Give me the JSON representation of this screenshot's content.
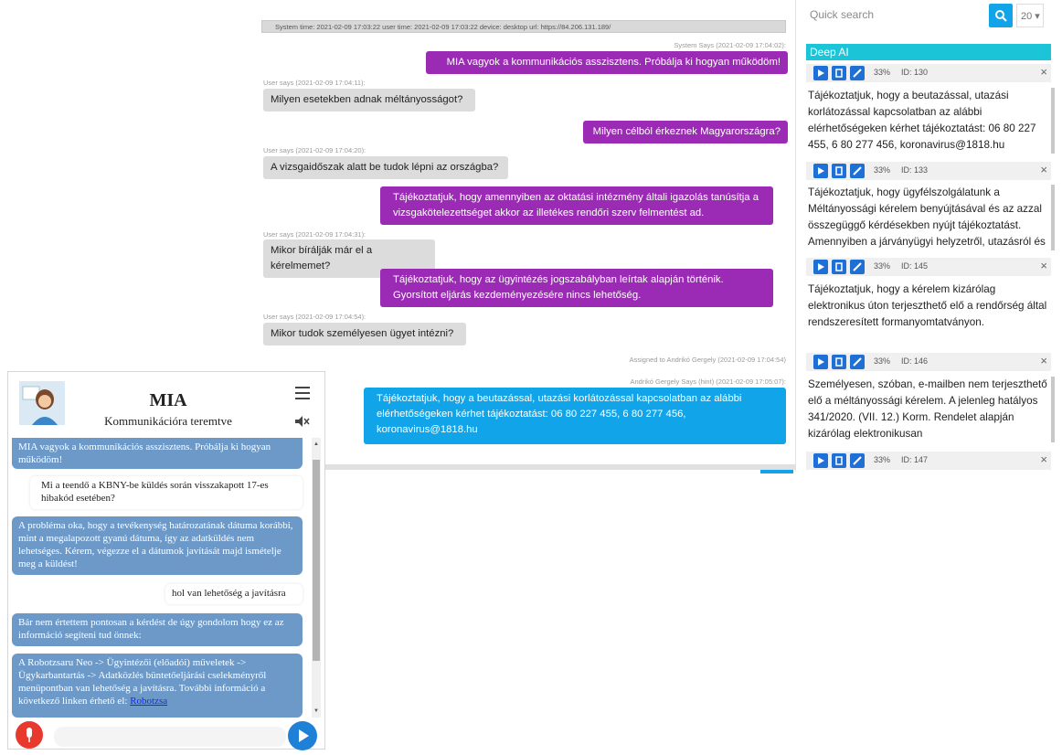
{
  "console": {
    "system_bar": "System time: 2021-02-09 17:03:22  user time: 2021-02-09 17:03:22  device: desktop  url: https://84.206.131.189/",
    "messages": [
      {
        "meta": "System Says (2021-02-09 17:04:02):",
        "text": "MIA vagyok a kommunikációs asszisztens. Próbálja ki hogyan működöm!"
      },
      {
        "meta": "User says (2021-02-09 17:04:11):",
        "text": "Milyen esetekben adnak méltányosságot?"
      },
      {
        "meta": "",
        "text": "Milyen célból érkeznek Magyarországra?"
      },
      {
        "meta": "User says (2021-02-09 17:04:20):",
        "text": "A vizsgaidőszak alatt be tudok lépni az országba?"
      },
      {
        "meta": "",
        "text": "Tájékoztatjuk, hogy amennyiben az oktatási intézmény általi igazolás tanúsítja a vizsgakötelezettséget akkor az illetékes rendőri szerv felmentést ad."
      },
      {
        "meta": "User says (2021-02-09 17:04:31):",
        "text": "Mikor bírálják már el a kérelmemet?"
      },
      {
        "meta": "",
        "text": "Tájékoztatjuk, hogy az ügyintézés jogszabályban leírtak alapján történik. Gyorsított eljárás kezdeményezésére nincs lehetőség."
      },
      {
        "meta": "User says (2021-02-09 17:04:54):",
        "text": "Mikor tudok személyesen ügyet intézni?"
      },
      {
        "meta": "Assigned to Andrikó Gergely (2021-02-09 17:04:54)",
        "text": ""
      },
      {
        "meta": "Andrikó Gergely Says (hint) (2021-02-09 17:05:07):",
        "text": "Tájékoztatjuk, hogy a beutazással, utazási korlátozással kapcsolatban az alábbi elérhetőségeken kérhet tájékoztatást: 06 80 227 455, 6 80 277 456, koronavirus@1818.hu"
      }
    ]
  },
  "right_panel": {
    "search_placeholder": "Quick search",
    "count": "20 ▾",
    "section_title": "Deep AI",
    "cards": [
      {
        "pct": "33%",
        "id": "ID: 130",
        "text": "Tájékoztatjuk, hogy a beutazással, utazási korlátozással kapcsolatban az alábbi elérhetőségeken kérhet tájékoztatást: 06 80 227 455, 6 80 277 456, koronavirus@1818.hu"
      },
      {
        "pct": "33%",
        "id": "ID: 133",
        "text": "Tájékoztatjuk, hogy ügyfélszolgálatunk a Méltányossági kérelem benyújtásával és az azzal összegüggő kérdésekben nyújt tájékoztatást. Amennyiben a járványügyi helyzetről, utazásról és"
      },
      {
        "pct": "33%",
        "id": "ID: 145",
        "text": "Tájékoztatjuk, hogy a kérelem kizárólag elektronikus úton terjeszthető elő a rendőrség által rendszeresített formanyomtatványon."
      },
      {
        "pct": "33%",
        "id": "ID: 146",
        "text": "Személyesen, szóban, e-mailben nem terjeszthető elő a méltányossági kérelem. A jelenleg hatályos 341/2020. (VII. 12.) Korm. Rendelet alapján kizárólag elektronikusan"
      },
      {
        "pct": "33%",
        "id": "ID: 147",
        "text": ""
      }
    ],
    "colors": {
      "accent": "#12a4e8",
      "section": "#1cc4d8",
      "icon_button": "#1e6fd6"
    }
  },
  "mia": {
    "title": "MIA",
    "subtitle": "Kommunikációra teremtve",
    "messages": [
      {
        "from": "bot",
        "text": "MIA vagyok a kommunikációs asszisztens. Próbálja ki hogyan működöm!"
      },
      {
        "from": "user",
        "text": "Mi a teendő a KBNY-be küldés során visszakapott 17-es hibakód esetében?"
      },
      {
        "from": "bot",
        "text": "A probléma oka, hogy a tevékenység határozatának dátuma korábbi, mint a megalapozott gyanú dátuma, így az adatküldés nem lehetséges. Kérem, végezze el a dátumok javítását majd ismételje meg a küldést!"
      },
      {
        "from": "user",
        "text": "hol van lehetőség a javításra"
      },
      {
        "from": "bot",
        "text": "Bár nem értettem pontosan a kérdést de úgy gondolom hogy ez az információ segíteni tud önnek:"
      },
      {
        "from": "bot",
        "text": "A Robotzsaru Neo -> Ügyintézői (előadói) műveletek -> Ügykarbantartás -> Adatközlés büntetőeljárási cselekményről menüpontban van lehetőség a javításra. További információ a következő linken érhető el: ",
        "link": "Robotzsa"
      }
    ],
    "input_value": "",
    "colors": {
      "bot_bubble": "#6c99c8",
      "mic": "#e8392e",
      "send": "#1e80d6"
    }
  }
}
